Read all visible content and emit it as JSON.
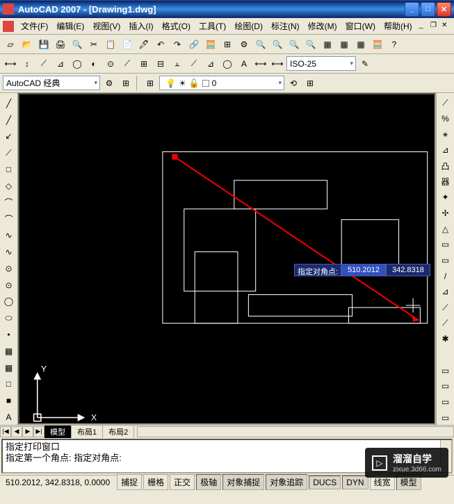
{
  "title": "AutoCAD 2007 - [Drawing1.dwg]",
  "menubar": [
    "文件(F)",
    "编辑(E)",
    "视图(V)",
    "插入(I)",
    "格式(O)",
    "工具(T)",
    "绘图(D)",
    "标注(N)",
    "修改(M)",
    "窗口(W)",
    "帮助(H)"
  ],
  "workspace_combo": "AutoCAD 经典",
  "dim_style_combo": "ISO-25",
  "layer_current": "0",
  "dynamic_input": {
    "label": "指定对角点:",
    "val1": "510.2012",
    "val2": "342.8318"
  },
  "model_tabs": {
    "nav": [
      "|◀",
      "◀",
      "▶",
      "▶|"
    ],
    "tabs": [
      "模型",
      "布局1",
      "布局2"
    ],
    "active": 0
  },
  "command_lines": [
    "指定打印窗口",
    "指定第一个角点: 指定对角点:"
  ],
  "statusbar": {
    "coords": "510.2012, 342.8318, 0.0000",
    "buttons": [
      "捕捉",
      "栅格",
      "正交",
      "极轴",
      "对象捕捉",
      "对象追踪",
      "DUCS",
      "DYN",
      "线宽",
      "模型"
    ]
  },
  "watermark": {
    "brand": "溜溜自学",
    "url": "zixue.3d66.com"
  },
  "left_tools": [
    "╱",
    "╱",
    "↙",
    "⟋",
    "□",
    "◇",
    "⌒",
    "⌒",
    "∿",
    "∿",
    "⊙",
    "⊙",
    "◯",
    "⬭",
    "•",
    "▦",
    "▦",
    "□",
    "■",
    "A"
  ],
  "right_tools": [
    "⟋",
    "%",
    "⚹",
    "⊿",
    "凸",
    "器",
    "✦",
    "✢",
    "△",
    "▭",
    "▭",
    "/",
    "⊿",
    "⟋",
    "⟋",
    "✱",
    " ",
    "▭",
    "▭",
    "▭",
    "▭"
  ],
  "std_tools": [
    "▱",
    "📂",
    "💾",
    "🖨",
    "🔍",
    "✂",
    "📋",
    "📄",
    "🖊",
    "↶",
    "↷",
    "🔗",
    "🧮",
    "⊞",
    "⚙",
    "🔍",
    "🔍",
    "🔍",
    "🔍",
    "▦",
    "▦",
    "▦",
    "🧮",
    "?"
  ],
  "dim_tools": [
    "⟷",
    "↕",
    "⟋",
    "⊿",
    "◯",
    "◐",
    "⊙",
    "⟋",
    "⊞",
    "⊟",
    "⫠",
    "⟋",
    "⊿",
    "◯",
    "A",
    "⟷",
    "⟷"
  ],
  "ws_tools": [
    "⚙",
    "⊞"
  ],
  "layer_tools": [
    "⊞",
    "💡",
    "❄",
    "🔒",
    "▢"
  ]
}
